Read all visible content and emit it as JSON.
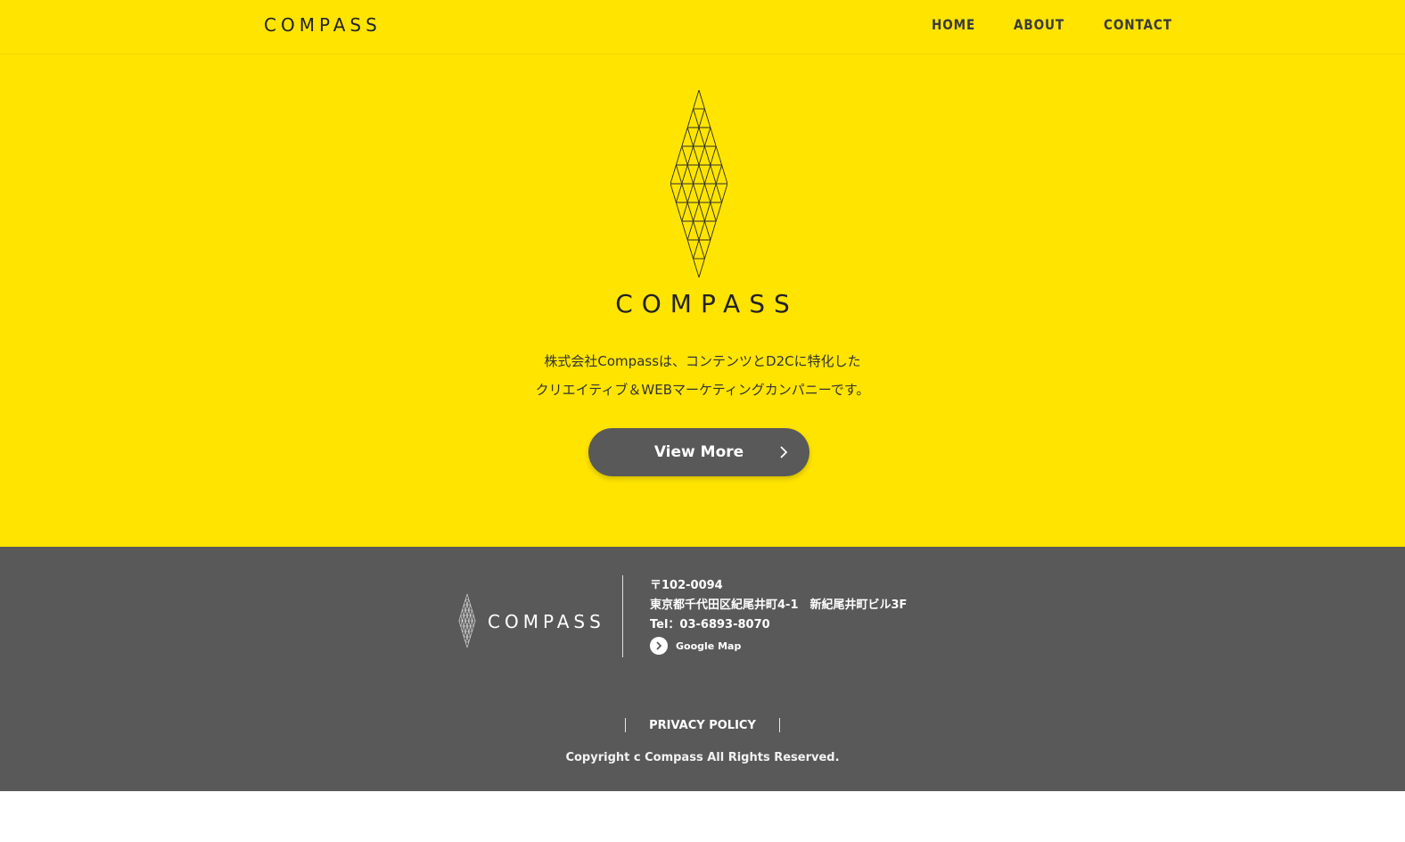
{
  "colors": {
    "brand_yellow": "#ffe400",
    "dark_gray": "#595959",
    "text_dark": "#333333",
    "white": "#ffffff"
  },
  "header": {
    "logo_text": "COMPASS",
    "nav": [
      {
        "label": "HOME"
      },
      {
        "label": "ABOUT"
      },
      {
        "label": "CONTACT"
      }
    ]
  },
  "hero": {
    "logo_icon": "diamond-lattice-icon",
    "logo_text": "COMPASS",
    "tagline_line1": "株式会社Compassは、コンテンツとD2Cに特化した",
    "tagline_line2": "クリエイティブ＆WEBマーケティングカンパニーです。",
    "button_label": "View More",
    "button_icon": "chevron-right-icon"
  },
  "footer": {
    "logo_text": "COMPASS",
    "postal": "〒102-0094",
    "address": "東京都千代田区紀尾井町4-1　新紀尾井町ビル3F",
    "tel": "Tel：03-6893-8070",
    "map_link": "Google Map",
    "map_icon": "chevron-right-circle-icon",
    "privacy_label": "PRIVACY POLICY",
    "copyright": "Copyright c Compass All Rights Reserved."
  }
}
